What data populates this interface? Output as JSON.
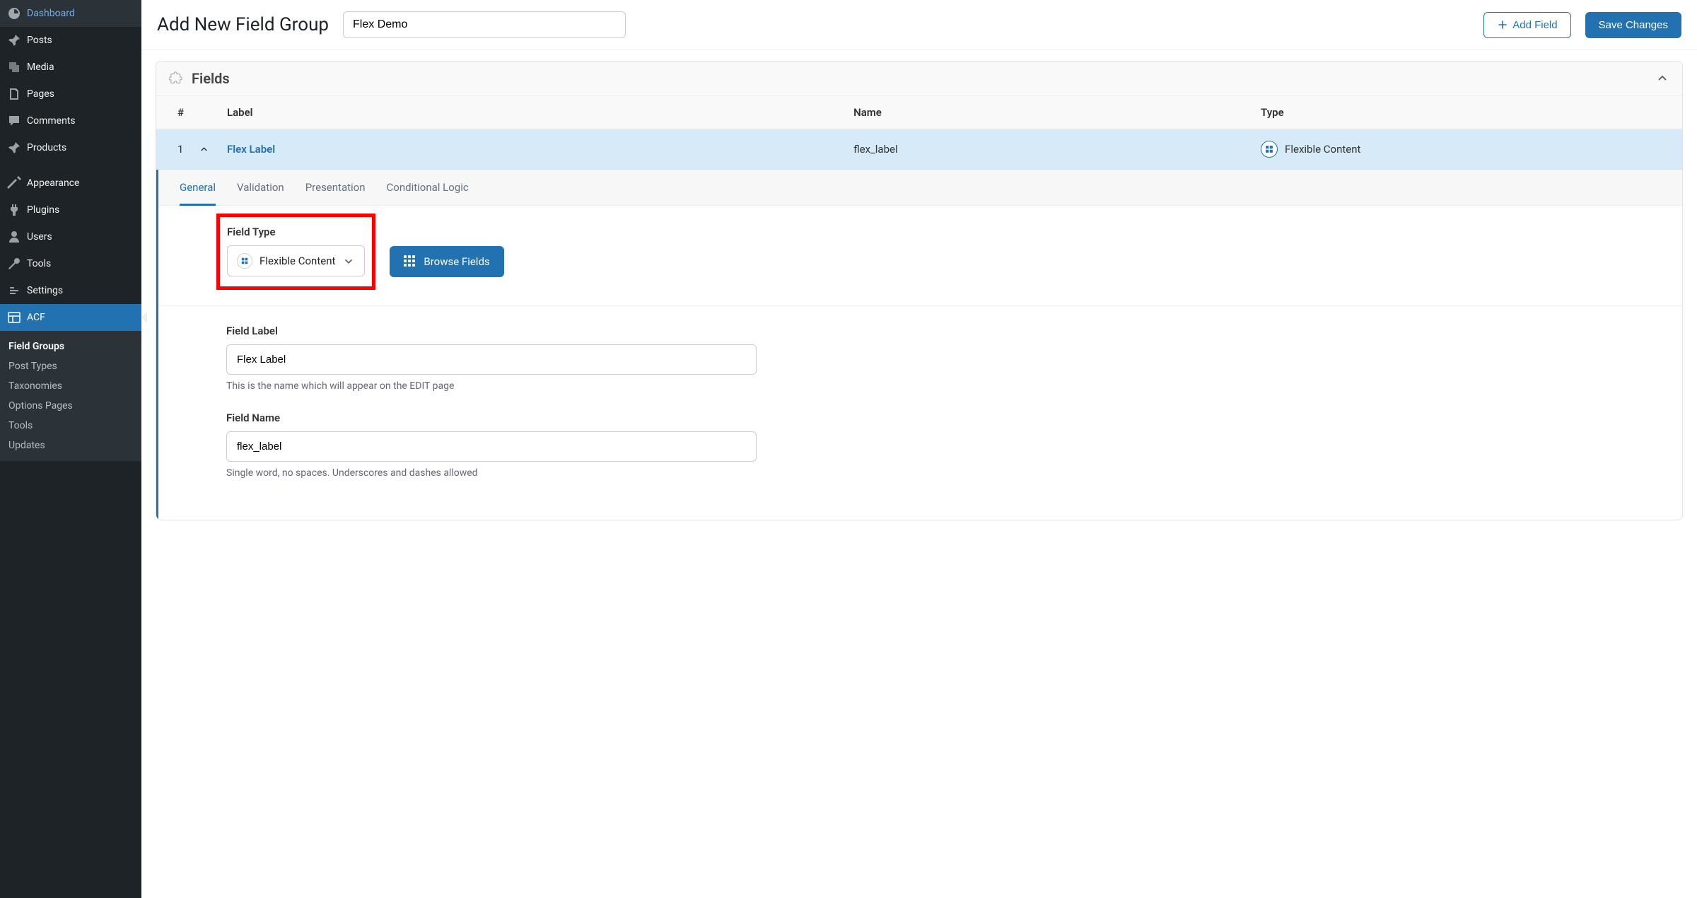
{
  "sidebar": {
    "items": [
      {
        "label": "Dashboard",
        "icon": "dashboard"
      },
      {
        "label": "Posts",
        "icon": "pin"
      },
      {
        "label": "Media",
        "icon": "media"
      },
      {
        "label": "Pages",
        "icon": "pages"
      },
      {
        "label": "Comments",
        "icon": "comments"
      },
      {
        "label": "Products",
        "icon": "pin"
      },
      {
        "label": "Appearance",
        "icon": "appearance"
      },
      {
        "label": "Plugins",
        "icon": "plugins"
      },
      {
        "label": "Users",
        "icon": "users"
      },
      {
        "label": "Tools",
        "icon": "tools"
      },
      {
        "label": "Settings",
        "icon": "settings"
      },
      {
        "label": "ACF",
        "icon": "acf"
      }
    ],
    "submenu": [
      {
        "label": "Field Groups",
        "current": true
      },
      {
        "label": "Post Types"
      },
      {
        "label": "Taxonomies"
      },
      {
        "label": "Options Pages"
      },
      {
        "label": "Tools"
      },
      {
        "label": "Updates"
      }
    ]
  },
  "header": {
    "title": "Add New Field Group",
    "group_name": "Flex Demo",
    "add_field": "Add Field",
    "save": "Save Changes"
  },
  "fields_panel": {
    "title": "Fields",
    "columns": {
      "num": "#",
      "label": "Label",
      "name": "Name",
      "type": "Type"
    },
    "row": {
      "num": "1",
      "label": "Flex Label",
      "name": "flex_label",
      "type": "Flexible Content"
    }
  },
  "tabs": [
    "General",
    "Validation",
    "Presentation",
    "Conditional Logic"
  ],
  "form": {
    "field_type_label": "Field Type",
    "field_type_value": "Flexible Content",
    "browse_fields": "Browse Fields",
    "field_label_label": "Field Label",
    "field_label_value": "Flex Label",
    "field_label_help": "This is the name which will appear on the EDIT page",
    "field_name_label": "Field Name",
    "field_name_value": "flex_label",
    "field_name_help": "Single word, no spaces. Underscores and dashes allowed"
  }
}
